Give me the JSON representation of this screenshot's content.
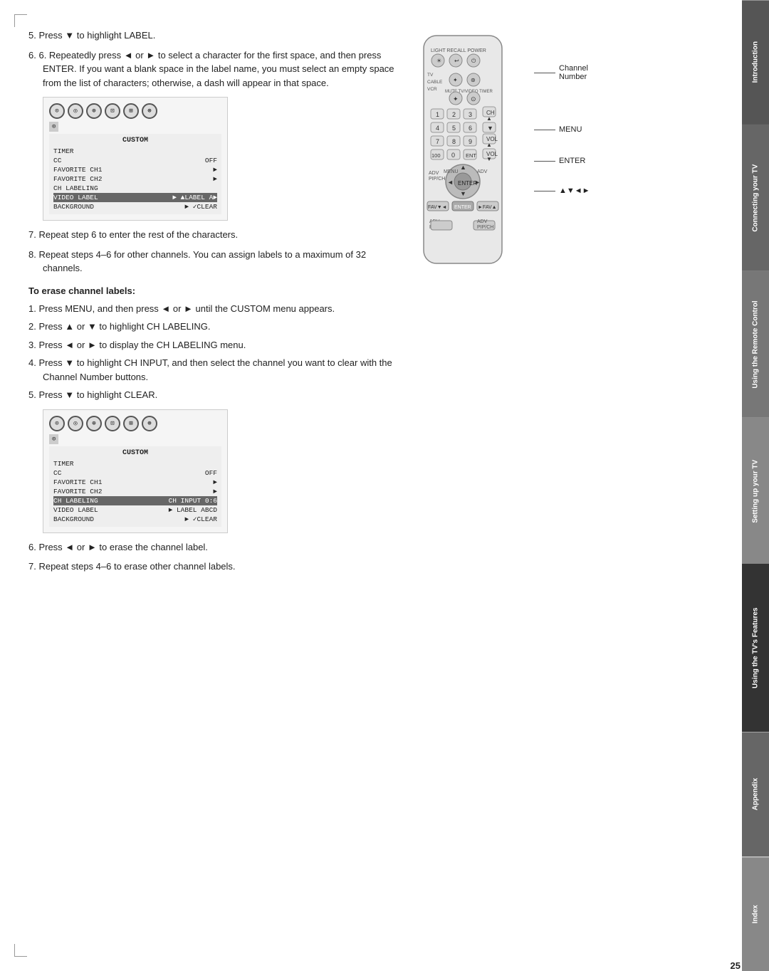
{
  "page": {
    "number": "25",
    "corners": true
  },
  "sidebar": {
    "tabs": [
      {
        "id": "introduction",
        "label": "Introduction",
        "class": "tab-introduction"
      },
      {
        "id": "connecting",
        "label": "Connecting your TV",
        "class": "tab-connecting"
      },
      {
        "id": "remote",
        "label": "Using the Remote Control",
        "class": "tab-remote"
      },
      {
        "id": "setting",
        "label": "Setting up your TV",
        "class": "tab-setting"
      },
      {
        "id": "features",
        "label": "Using the TV's Features",
        "class": "tab-features"
      },
      {
        "id": "appendix",
        "label": "Appendix",
        "class": "tab-appendix"
      },
      {
        "id": "index",
        "label": "Index",
        "class": "tab-index"
      }
    ]
  },
  "content": {
    "step5": "5. Press ▼ to highlight LABEL.",
    "step6": "6. Repeatedly press ◄ or ► to select a character for the first space, and then press ENTER. If you want a blank space in the label name, you must select an empty space from the list of characters; otherwise, a dash will appear in that space.",
    "step7": "7. Repeat step 6 to enter the rest of the characters.",
    "step8": "8. Repeat steps 4–6 for other channels. You can assign labels to a maximum of 32 channels.",
    "erase_heading": "To erase channel labels:",
    "erase_steps": [
      "1. Press MENU, and then press ◄ or ► until the CUSTOM menu appears.",
      "2. Press ▲ or ▼ to highlight CH LABELING.",
      "3. Press ◄ or ► to display the CH LABELING menu.",
      "4. Press ▼ to highlight CH INPUT, and then select the channel you want to clear with the Channel Number buttons.",
      "5. Press ▼ to highlight CLEAR."
    ],
    "step6b": "6. Press ◄ or ► to erase the channel label.",
    "step7b": "7. Repeat steps 4–6 to erase other channel labels."
  },
  "menu1": {
    "title": "CUSTOM",
    "rows": [
      {
        "label": "TIMER",
        "value": "",
        "highlighted": false
      },
      {
        "label": "CC",
        "value": "OFF",
        "highlighted": false
      },
      {
        "label": "FAVORITE CH1",
        "value": "►",
        "highlighted": false
      },
      {
        "label": "FAVORITE CH2",
        "value": "►",
        "highlighted": false
      },
      {
        "label": "CH LABELING",
        "value": "",
        "highlighted": false
      },
      {
        "label": "VIDEO LABEL",
        "value": "►  ▲LABEL    A►",
        "highlighted": true
      },
      {
        "label": "BACKGROUND",
        "value": "►  ✓CLEAR",
        "highlighted": false
      }
    ]
  },
  "menu2": {
    "title": "CUSTOM",
    "rows": [
      {
        "label": "TIMER",
        "value": "",
        "highlighted": false
      },
      {
        "label": "CC",
        "value": "OFF",
        "highlighted": false
      },
      {
        "label": "FAVORITE CH1",
        "value": "►",
        "highlighted": false
      },
      {
        "label": "FAVORITE CH2",
        "value": "►",
        "highlighted": false
      },
      {
        "label": "CH LABELING",
        "value": "CH INPUT    0:6",
        "highlighted": true
      },
      {
        "label": "VIDEO LABEL",
        "value": "►  LABEL    ABCD",
        "highlighted": false
      },
      {
        "label": "BACKGROUND",
        "value": "►  ✓CLEAR",
        "highlighted": false
      }
    ]
  },
  "remote_labels": {
    "channel_number": "Channel\nNumber",
    "menu": "MENU",
    "enter": "ENTER",
    "arrows": "▲▼◄►"
  }
}
